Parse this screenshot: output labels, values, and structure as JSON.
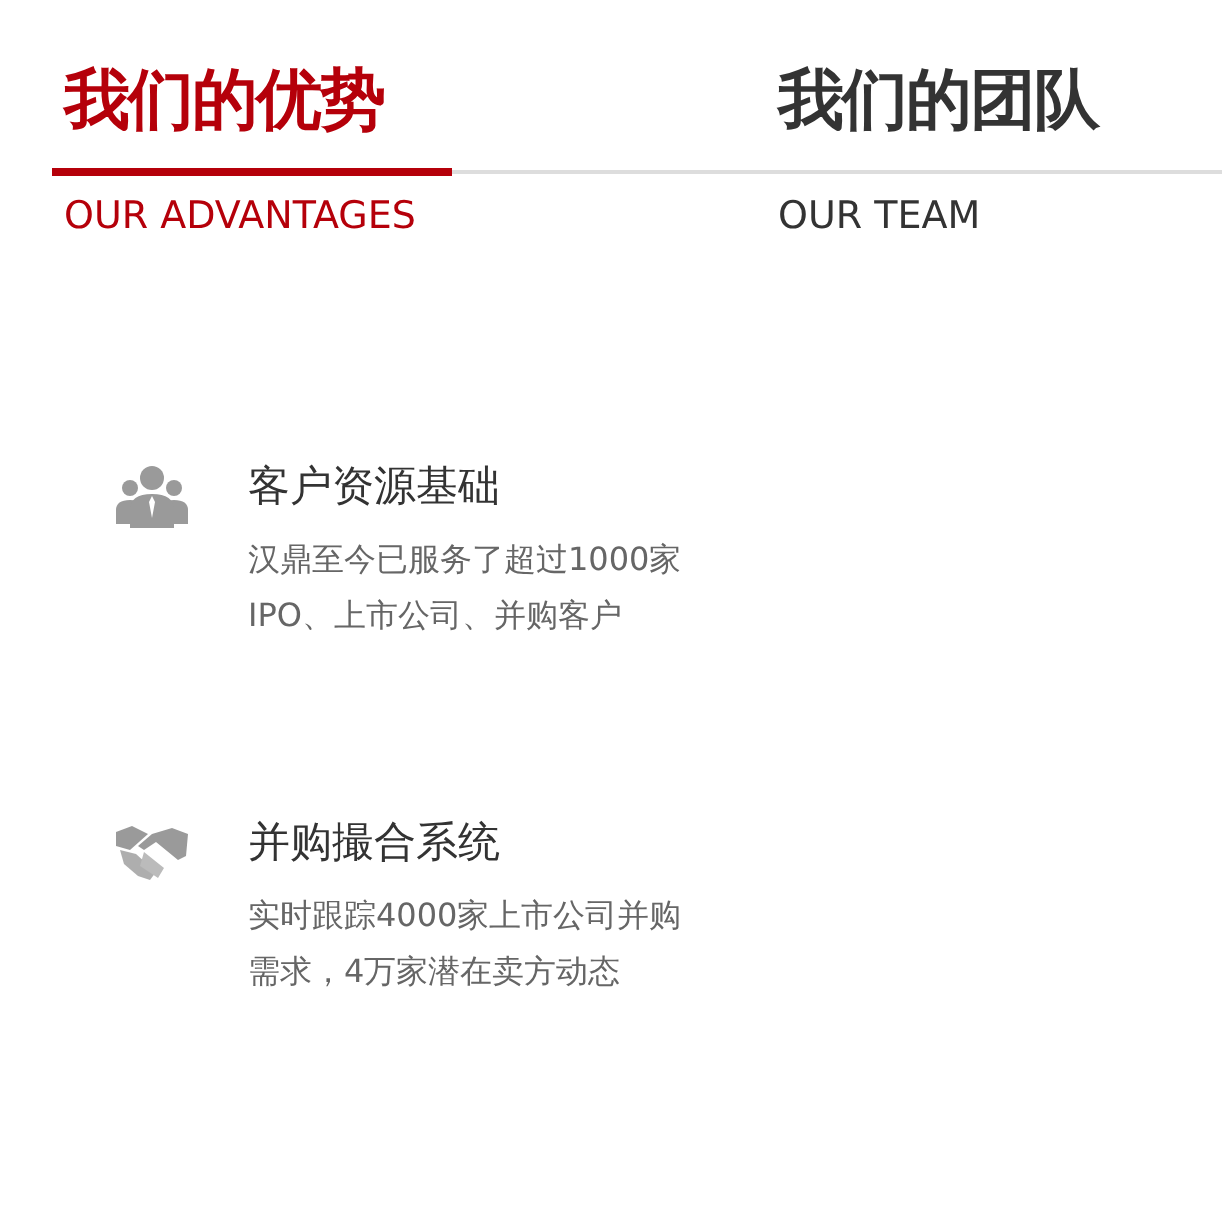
{
  "tabs": [
    {
      "title": "我们的优势",
      "subtitle": "OUR ADVANTAGES",
      "selected": true
    },
    {
      "title": "我们的团队",
      "subtitle": "OUR TEAM",
      "selected": false
    }
  ],
  "features": [
    {
      "kind": "people",
      "title": "客户资源基础",
      "lines": [
        "汉鼎至今已服务了超过1000家",
        "IPO、上市公司、并购客户"
      ]
    },
    {
      "kind": "handshake",
      "title": "并购撮合系统",
      "lines": [
        "实时跟踪4000家上市公司并购",
        "需求，4万家潜在卖方动态"
      ]
    }
  ]
}
